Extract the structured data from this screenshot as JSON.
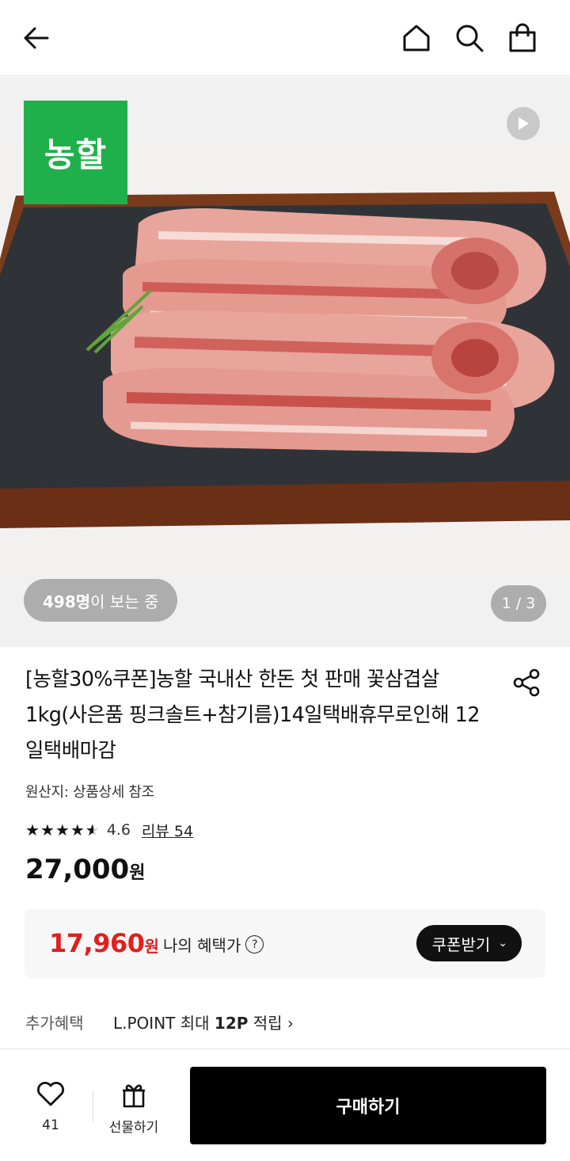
{
  "header": {
    "back_icon": "arrow-left-icon",
    "home_icon": "home-icon",
    "search_icon": "search-icon",
    "cart_icon": "shopping-bag-icon"
  },
  "media": {
    "brand_logo_text": "농할",
    "play_icon": "play-icon",
    "viewers_count": "498명",
    "viewers_suffix": "이 보는 중",
    "pager": "1 / 3"
  },
  "product": {
    "title": "[농할30%쿠폰]농할 국내산 한돈 첫 판매 꽃삼겹살1kg(사은품 핑크솔트+참기름)14일택배휴무로인해 12일택배마감",
    "origin": "원산지: 상품상세 참조",
    "rating": "4.6",
    "rating_stars": 4.6,
    "review_link": "리뷰 54",
    "price_value": "27,000",
    "price_unit": "원"
  },
  "benefit": {
    "price_value": "17,960",
    "price_unit": "원",
    "label": "나의 혜택가",
    "help_icon": "question-circle-icon",
    "coupon_button": "쿠폰받기",
    "accent_color": "#e0201f"
  },
  "extra_benefit": {
    "label": "추가혜택",
    "value_prefix": "L.POINT 최대 ",
    "value_bold": "12P",
    "value_suffix": " 적립 ›"
  },
  "bottom_bar": {
    "like_count": "41",
    "gift_label": "선물하기",
    "buy_button": "구매하기"
  }
}
